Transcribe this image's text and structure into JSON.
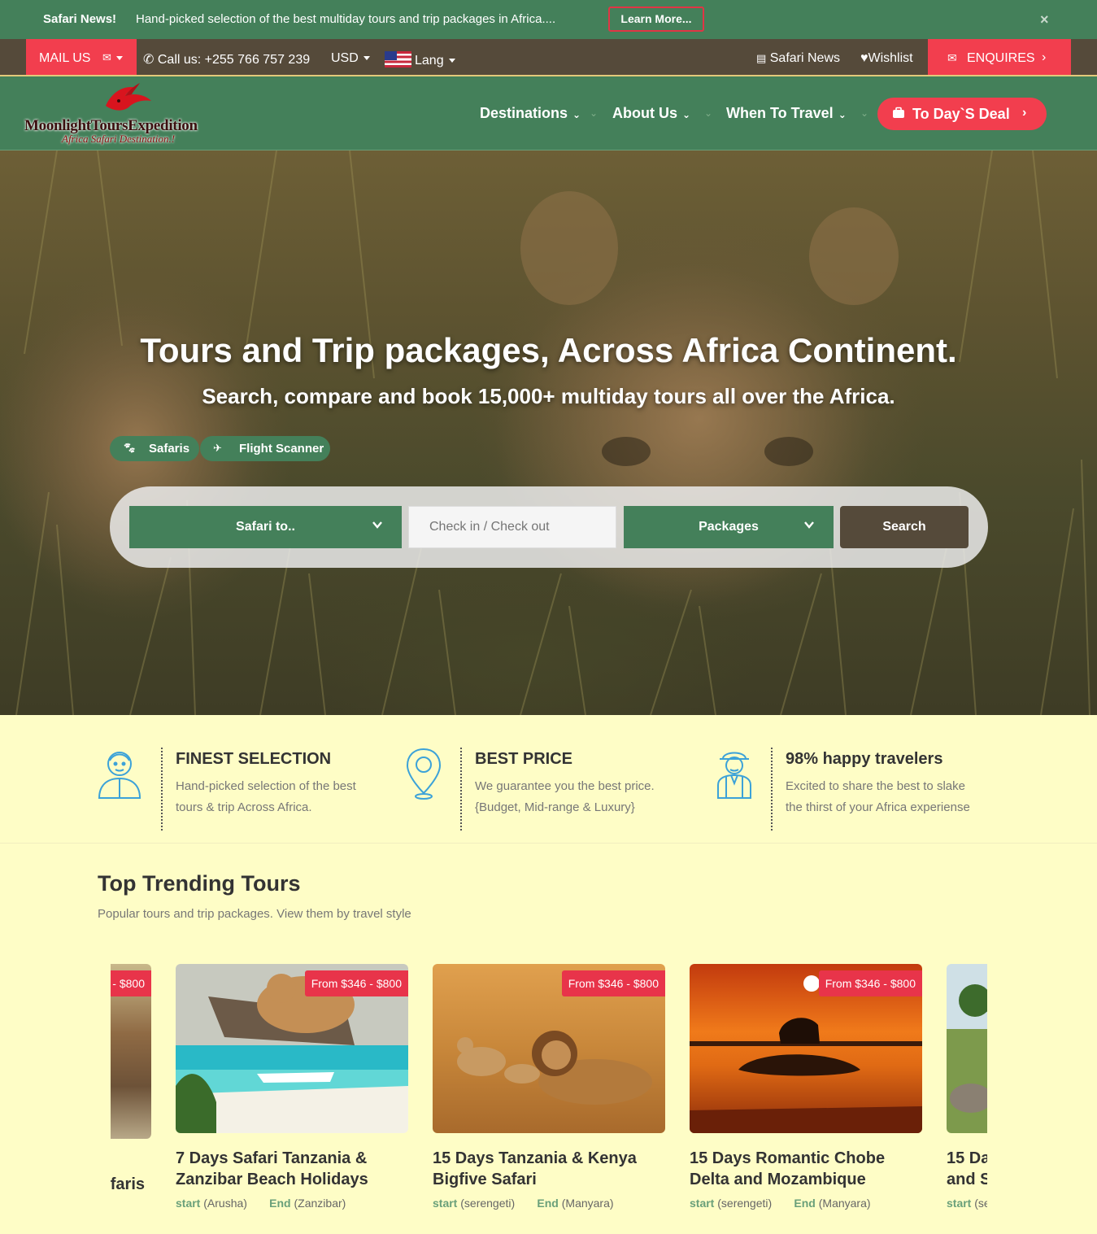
{
  "news_bar": {
    "title": "Safari News!",
    "text": "Hand-picked selection of the best multiday tours and trip packages in Africa....",
    "button": "Learn More...",
    "close": "×"
  },
  "utility_bar": {
    "mail_label": "MAIL US",
    "call_label": "Call us: +255 766 757 239",
    "currency": "USD",
    "lang": "Lang",
    "safari_news": "Safari News",
    "wishlist": "Wishlist",
    "enquires": "ENQUIRES"
  },
  "brand": {
    "name": "MoonlightToursExpedition",
    "tagline": "Africa Safari Destination.!"
  },
  "nav": {
    "items": [
      {
        "label": "Destinations"
      },
      {
        "label": "About Us"
      },
      {
        "label": "When To Travel"
      }
    ],
    "deal_label": "To Day`S Deal"
  },
  "hero": {
    "title": "Tours and Trip packages, Across Africa Continent.",
    "subtitle": "Search, compare and book 15,000+ multiday tours all over the Africa.",
    "tabs": [
      {
        "label": "Safaris",
        "icon": "paw-icon"
      },
      {
        "label": "Flight Scanner",
        "icon": "plane-icon"
      }
    ],
    "search": {
      "destination": "Safari to..",
      "dates_placeholder": "Check in / Check out",
      "package": "Packages",
      "button": "Search"
    }
  },
  "features": [
    {
      "title": "FINEST SELECTION",
      "line1": "Hand-picked selection of the best",
      "line2": "tours & trip Across Africa.",
      "icon": "person-icon"
    },
    {
      "title": "BEST PRICE",
      "line1": "We guarantee you the best price.",
      "line2": "{Budget, Mid-range & Luxury}",
      "icon": "location-pin-icon"
    },
    {
      "title": "98% happy travelers",
      "line1": "Excited to share the best to slake",
      "line2": "the thirst of your Africa experiense",
      "icon": "traveler-icon"
    }
  ],
  "trending": {
    "title": "Top Trending Tours",
    "subtitle": "Popular tours and trip packages. View them by travel style",
    "tours": [
      {
        "price": "From $346 - $800",
        "title": "7 Days Safari Tanzania & Zanzibar Beach Holidays",
        "start_label": "start",
        "start": "(Arusha)",
        "end_label": "End",
        "end": "(Zanzibar)"
      },
      {
        "price": "From $346 - $800",
        "title": "15 Days Tanzania & Kenya Bigfive Safari",
        "start_label": "start",
        "start": "(serengeti)",
        "end_label": "End",
        "end": "(Manyara)"
      },
      {
        "price": "From $346 - $800",
        "title": "15 Days Romantic Chobe Delta and Mozambique",
        "start_label": "start",
        "start": "(serengeti)",
        "end_label": "End",
        "end": "(Manyara)"
      }
    ],
    "partial_left": {
      "price": "- $800",
      "title": "faris"
    },
    "partial_right": {
      "title_line1": "15 Da",
      "title_line2": "and S",
      "start_label": "start",
      "start": "(se"
    }
  },
  "colors": {
    "primary_green": "#44805a",
    "accent_red": "#f23e4e",
    "dark_brown": "#554a3a",
    "cream_bg": "#fefdc6"
  }
}
